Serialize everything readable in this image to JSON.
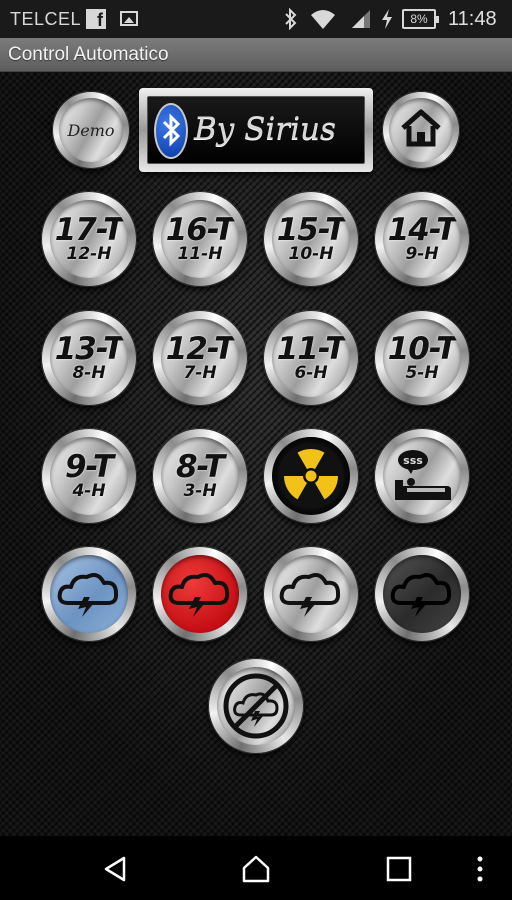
{
  "status_bar": {
    "carrier": "TELCEL",
    "battery_percent": "8%",
    "time": "11:48",
    "icons": [
      "facebook-icon",
      "image-icon",
      "bluetooth-icon",
      "wifi-icon",
      "cell-signal-icon",
      "charging-icon"
    ]
  },
  "app": {
    "title": "Control Automatico"
  },
  "top_row": {
    "demo_label": "Demo",
    "banner_label": "By Sirius",
    "home_icon": "home-icon"
  },
  "buttons": [
    {
      "main": "17-T",
      "sub": "12-H"
    },
    {
      "main": "16-T",
      "sub": "11-H"
    },
    {
      "main": "15-T",
      "sub": "10-H"
    },
    {
      "main": "14-T",
      "sub": "9-H"
    },
    {
      "main": "13-T",
      "sub": "8-H"
    },
    {
      "main": "12-T",
      "sub": "7-H"
    },
    {
      "main": "11-T",
      "sub": "6-H"
    },
    {
      "main": "10-T",
      "sub": "5-H"
    },
    {
      "main": "9-T",
      "sub": "4-H"
    },
    {
      "main": "8-T",
      "sub": "3-H"
    }
  ],
  "special_buttons": {
    "radiation_icon": "radiation-icon",
    "sleep_icon": "sleep-bed-icon",
    "sleep_text": "sss"
  },
  "storm_buttons": {
    "colors": [
      "#7da2cc",
      "#d4161c",
      "#bdbdbd",
      "#3a3a3a"
    ],
    "disabled_icon": "storm-off-icon"
  },
  "nav": {
    "icons": [
      "back-icon",
      "home-nav-icon",
      "recents-icon",
      "overflow-menu-icon"
    ]
  }
}
